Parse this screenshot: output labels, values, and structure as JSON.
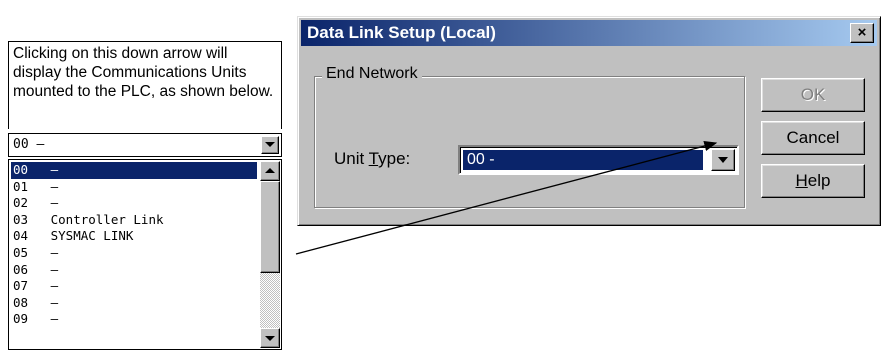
{
  "caption": {
    "text": "Clicking on this down arrow will display the Communications Units mounted to the PLC, as shown below."
  },
  "left_combo": {
    "value": "00   –"
  },
  "listbox": {
    "items": [
      {
        "label": "00   –"
      },
      {
        "label": "01   –"
      },
      {
        "label": "02   –"
      },
      {
        "label": "03   Controller Link"
      },
      {
        "label": "04   SYSMAC LINK"
      },
      {
        "label": "05   –"
      },
      {
        "label": "06   –"
      },
      {
        "label": "07   –"
      },
      {
        "label": "08   –"
      },
      {
        "label": "09   –"
      }
    ],
    "selected_index": 0
  },
  "dialog": {
    "title": "Data Link Setup (Local)",
    "close_label": "×",
    "group_label": "End Network",
    "unit_type_label_pre": "Unit ",
    "unit_type_label_accel": "T",
    "unit_type_label_post": "ype:",
    "unit_type_value": "00   -",
    "buttons": {
      "ok": "OK",
      "cancel": "Cancel",
      "help_accel": "H",
      "help_rest": "elp"
    }
  },
  "colors": {
    "title_start": "#0a246a",
    "title_end": "#a6caf0",
    "selection": "#0a246a",
    "face": "#c0c0c0"
  }
}
